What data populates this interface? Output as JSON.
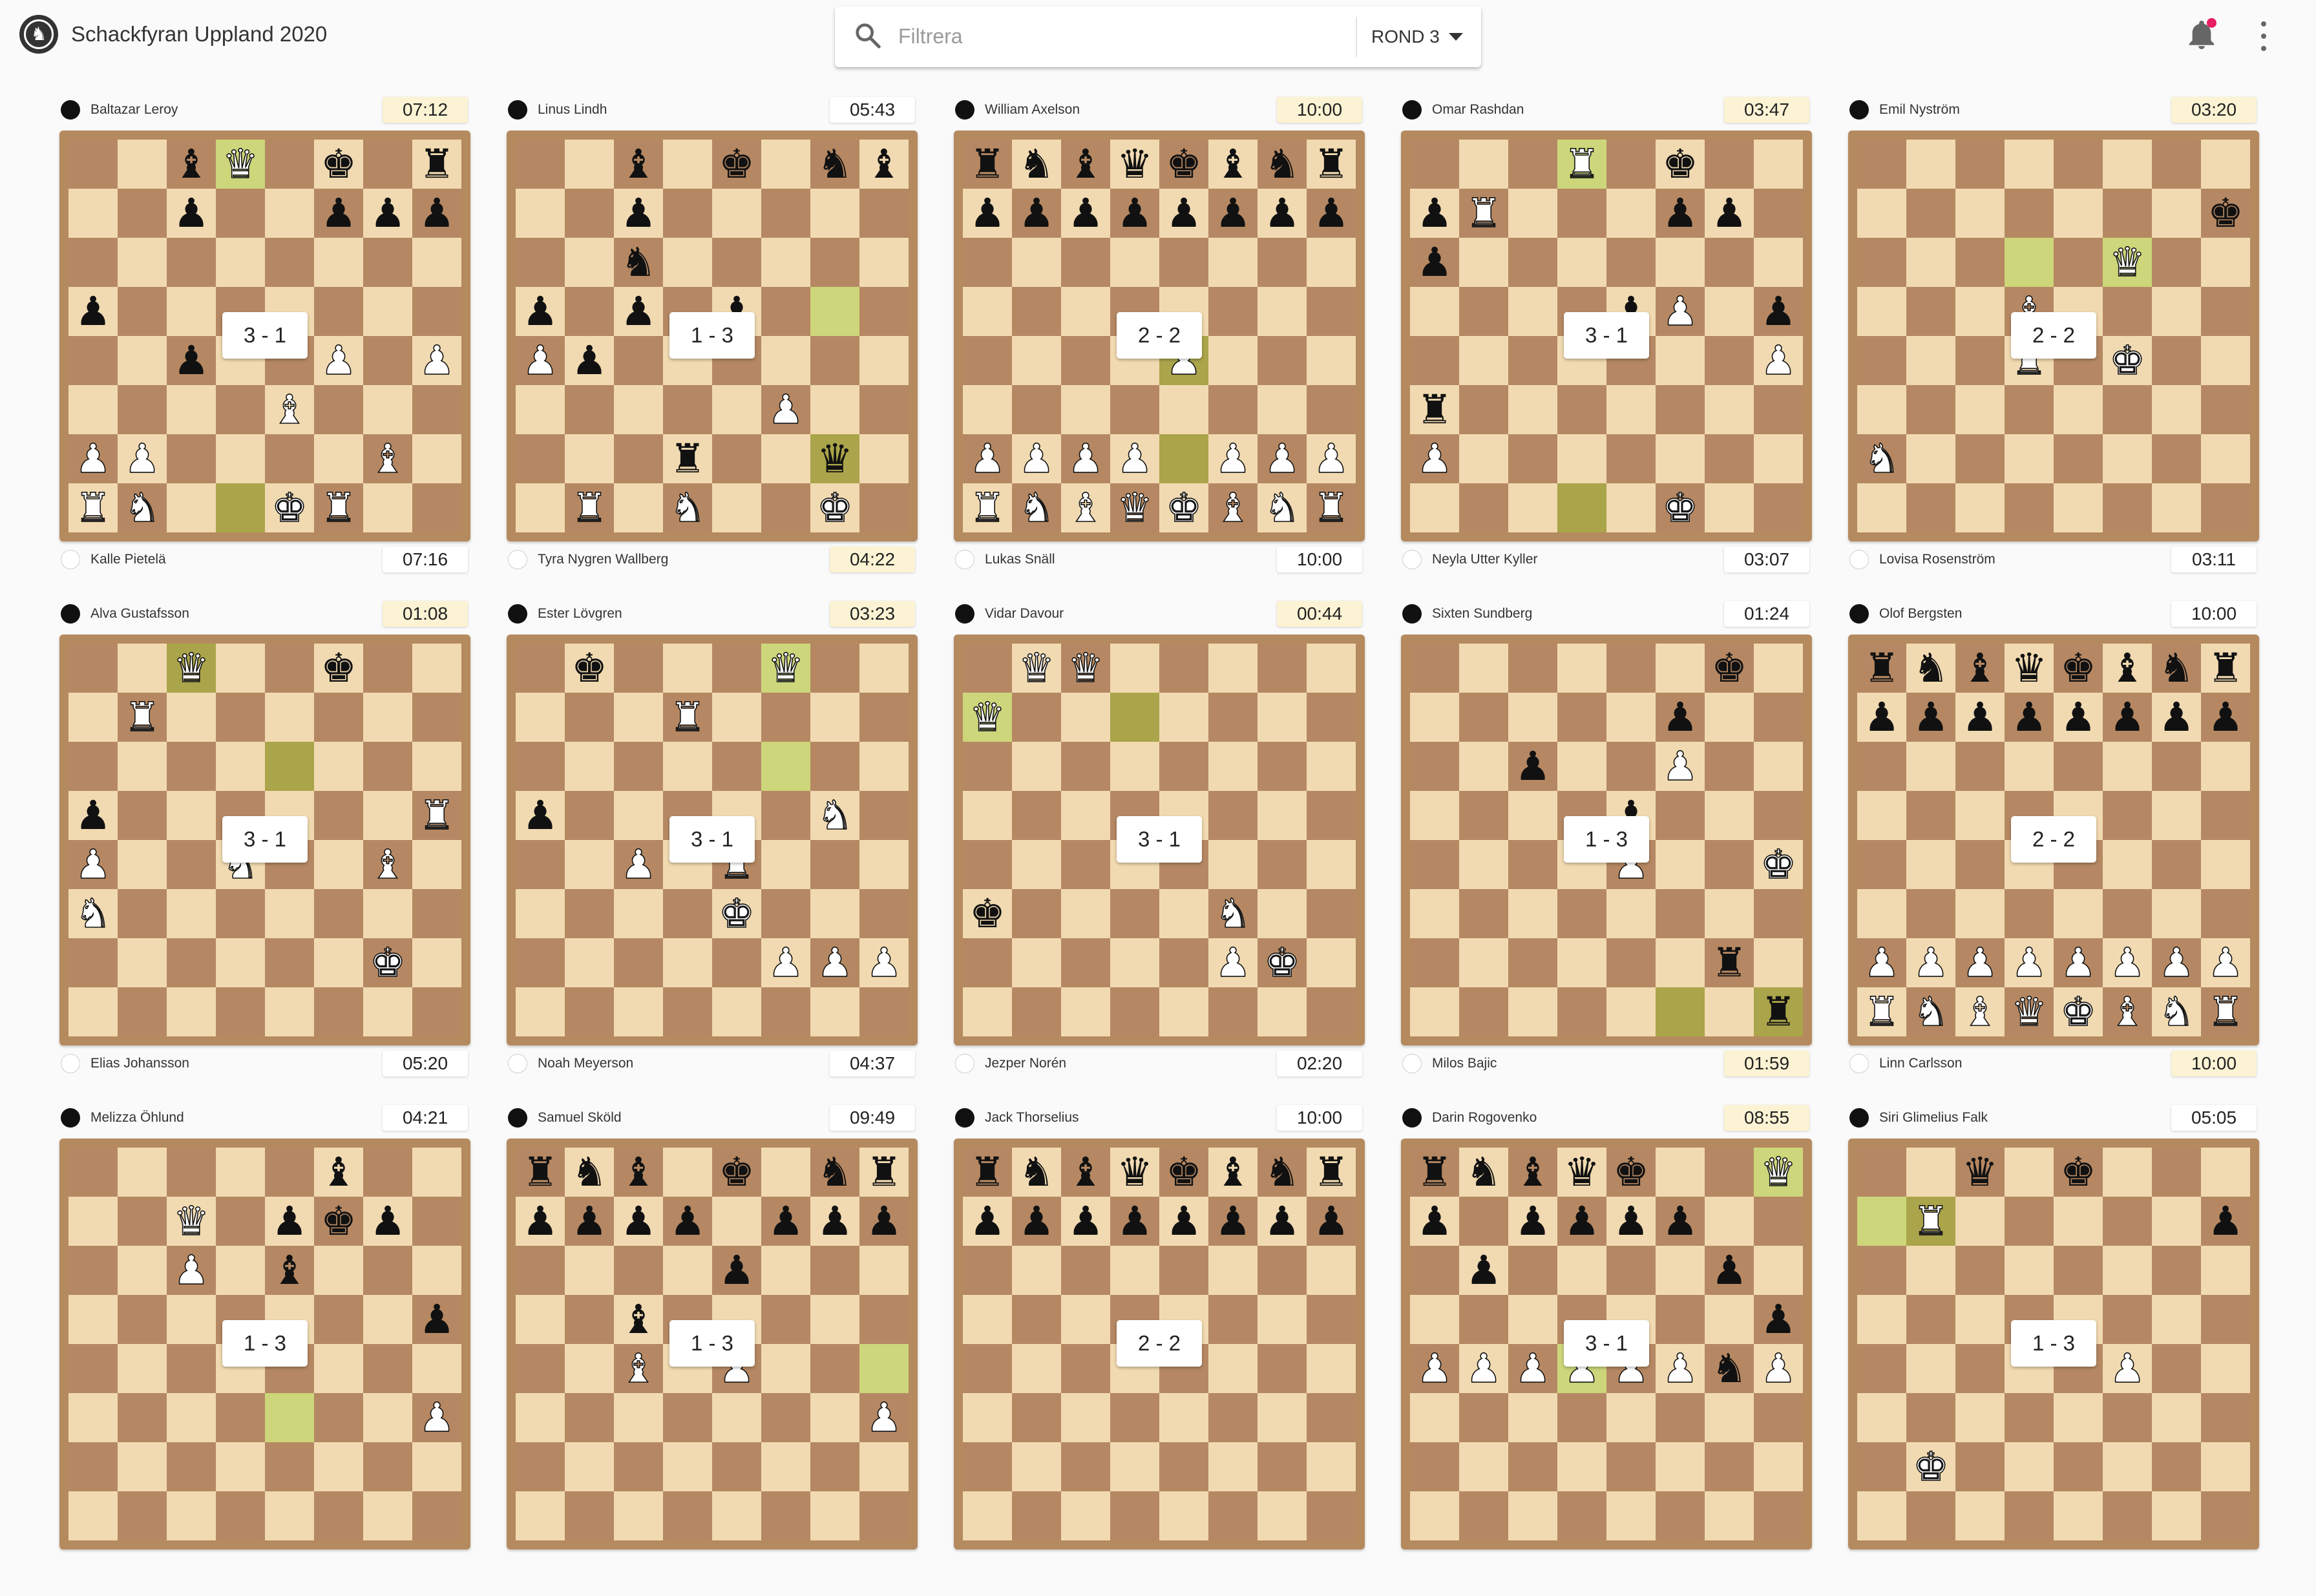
{
  "app": {
    "title": "Schackfyran Uppland 2020"
  },
  "search": {
    "placeholder": "Filtrera",
    "value": ""
  },
  "round": {
    "label": "ROND 3"
  },
  "colors": {
    "light_square": "#f1dab1",
    "dark_square": "#b58863",
    "highlight": "#cdd67a",
    "board_frame": "#b58a5f",
    "active_clock": "#fcf3d4",
    "notification_dot": "#e91e63"
  },
  "icons": {
    "logo": "chess-federation-logo",
    "search": "search-icon",
    "round_dropdown": "caret-down-icon",
    "notifications": "bell-icon",
    "menu": "more-vertical-icon"
  },
  "games": [
    {
      "top": {
        "name": "Baltazar Leroy",
        "color": "black",
        "clock": "07:12",
        "active": true
      },
      "bottom": {
        "name": "Kalle Pietelä",
        "color": "white",
        "clock": "07:16",
        "active": false
      },
      "score": "3 - 1",
      "highlights": [
        "d8",
        "d1"
      ],
      "pieces": {
        "c8": "bB",
        "d8": "wQ",
        "f8": "bK",
        "h8": "bR",
        "c7": "bP",
        "f7": "bP",
        "g7": "bP",
        "h7": "bP",
        "a5": "bP",
        "c4": "bP",
        "f4": "wP",
        "h4": "wP",
        "e3": "wB",
        "a2": "wP",
        "b2": "wP",
        "g2": "wB",
        "a1": "wR",
        "b1": "wN",
        "e1": "wK",
        "f1": "wR"
      }
    },
    {
      "top": {
        "name": "Linus Lindh",
        "color": "black",
        "clock": "05:43",
        "active": false
      },
      "bottom": {
        "name": "Tyra Nygren Wallberg",
        "color": "white",
        "clock": "04:22",
        "active": true
      },
      "score": "1 - 3",
      "highlights": [
        "g5",
        "g2"
      ],
      "pieces": {
        "c8": "bB",
        "e8": "bK",
        "g8": "bN",
        "h8": "bB",
        "c7": "bP",
        "c6": "bN",
        "a5": "bP",
        "c5": "bP",
        "e5": "bP",
        "a4": "wP",
        "b4": "bP",
        "f3": "wP",
        "d2": "bR",
        "g2": "bQ",
        "b1": "wR",
        "d1": "wN",
        "g1": "wK"
      }
    },
    {
      "top": {
        "name": "William Axelson",
        "color": "black",
        "clock": "10:00",
        "active": true
      },
      "bottom": {
        "name": "Lukas Snäll",
        "color": "white",
        "clock": "10:00",
        "active": false
      },
      "score": "2 - 2",
      "highlights": [
        "e4",
        "e2"
      ],
      "pieces": {
        "a8": "bR",
        "b8": "bN",
        "c8": "bB",
        "d8": "bQ",
        "e8": "bK",
        "f8": "bB",
        "g8": "bN",
        "h8": "bR",
        "a7": "bP",
        "b7": "bP",
        "c7": "bP",
        "d7": "bP",
        "e7": "bP",
        "f7": "bP",
        "g7": "bP",
        "h7": "bP",
        "e4": "wP",
        "a2": "wP",
        "b2": "wP",
        "c2": "wP",
        "d2": "wP",
        "f2": "wP",
        "g2": "wP",
        "h2": "wP",
        "a1": "wR",
        "b1": "wN",
        "c1": "wB",
        "d1": "wQ",
        "e1": "wK",
        "f1": "wB",
        "g1": "wN",
        "h1": "wR"
      }
    },
    {
      "top": {
        "name": "Omar Rashdan",
        "color": "black",
        "clock": "03:47",
        "active": true
      },
      "bottom": {
        "name": "Neyla Utter Kyller",
        "color": "white",
        "clock": "03:07",
        "active": false
      },
      "score": "3 - 1",
      "highlights": [
        "d8",
        "d1"
      ],
      "pieces": {
        "d8": "wR",
        "f8": "bK",
        "a7": "bP",
        "b7": "wR",
        "f7": "bP",
        "g7": "bP",
        "a6": "bP",
        "e5": "bP",
        "f5": "wP",
        "h5": "bP",
        "h4": "wP",
        "a3": "bR",
        "a2": "wP",
        "f1": "wK"
      }
    },
    {
      "top": {
        "name": "Emil Nyström",
        "color": "black",
        "clock": "03:20",
        "active": true
      },
      "bottom": {
        "name": "Lovisa Rosenström",
        "color": "white",
        "clock": "03:11",
        "active": false
      },
      "score": "2 - 2",
      "highlights": [
        "d6",
        "f6"
      ],
      "pieces": {
        "h7": "bK",
        "f6": "wQ",
        "d5": "wB",
        "d4": "wR",
        "f4": "wK",
        "a2": "wN"
      }
    },
    {
      "top": {
        "name": "Alva Gustafsson",
        "color": "black",
        "clock": "01:08",
        "active": true
      },
      "bottom": {
        "name": "Elias Johansson",
        "color": "white",
        "clock": "05:20",
        "active": false
      },
      "score": "3 - 1",
      "highlights": [
        "c8",
        "e6"
      ],
      "pieces": {
        "c8": "wQ",
        "f8": "bK",
        "b7": "wR",
        "a5": "bP",
        "h5": "wR",
        "a4": "wP",
        "d4": "wN",
        "g4": "wB",
        "a3": "wN",
        "g2": "wK"
      }
    },
    {
      "top": {
        "name": "Ester Lövgren",
        "color": "black",
        "clock": "03:23",
        "active": true
      },
      "bottom": {
        "name": "Noah Meyerson",
        "color": "white",
        "clock": "04:37",
        "active": false
      },
      "score": "3 - 1",
      "highlights": [
        "f8",
        "f6"
      ],
      "pieces": {
        "b8": "bK",
        "f8": "wQ",
        "d7": "wR",
        "a5": "bP",
        "g5": "wN",
        "c4": "wP",
        "e4": "wR",
        "e3": "wK",
        "f2": "wP",
        "g2": "wP",
        "h2": "wP"
      }
    },
    {
      "top": {
        "name": "Vidar Davour",
        "color": "black",
        "clock": "00:44",
        "active": true
      },
      "bottom": {
        "name": "Jezper Norén",
        "color": "white",
        "clock": "02:20",
        "active": false
      },
      "score": "3 - 1",
      "highlights": [
        "a7",
        "d7"
      ],
      "pieces": {
        "b8": "wQ",
        "c8": "wQ",
        "a7": "wQ",
        "a3": "bK",
        "f3": "wN",
        "f2": "wP",
        "g2": "wK"
      }
    },
    {
      "top": {
        "name": "Sixten Sundberg",
        "color": "black",
        "clock": "01:24",
        "active": false
      },
      "bottom": {
        "name": "Milos Bajic",
        "color": "white",
        "clock": "01:59",
        "active": true
      },
      "score": "1 - 3",
      "highlights": [
        "f1",
        "h1"
      ],
      "pieces": {
        "g8": "bK",
        "f7": "bP",
        "c6": "bP",
        "f6": "wP",
        "e5": "bP",
        "e4": "wP",
        "h4": "wK",
        "g2": "bR",
        "h1": "bR"
      }
    },
    {
      "top": {
        "name": "Olof Bergsten",
        "color": "black",
        "clock": "10:00",
        "active": false
      },
      "bottom": {
        "name": "Linn Carlsson",
        "color": "white",
        "clock": "10:00",
        "active": true
      },
      "score": "2 - 2",
      "highlights": [],
      "pieces": {
        "a8": "bR",
        "b8": "bN",
        "c8": "bB",
        "d8": "bQ",
        "e8": "bK",
        "f8": "bB",
        "g8": "bN",
        "h8": "bR",
        "a7": "bP",
        "b7": "bP",
        "c7": "bP",
        "d7": "bP",
        "e7": "bP",
        "f7": "bP",
        "g7": "bP",
        "h7": "bP",
        "a2": "wP",
        "b2": "wP",
        "c2": "wP",
        "d2": "wP",
        "e2": "wP",
        "f2": "wP",
        "g2": "wP",
        "h2": "wP",
        "a1": "wR",
        "b1": "wN",
        "c1": "wB",
        "d1": "wQ",
        "e1": "wK",
        "f1": "wB",
        "g1": "wN",
        "h1": "wR"
      }
    },
    {
      "top": {
        "name": "Melizza Öhlund",
        "color": "black",
        "clock": "04:21",
        "active": false
      },
      "bottom": {
        "name": "",
        "color": "white",
        "clock": "",
        "active": false
      },
      "score": "1 - 3",
      "highlights": [
        "e3"
      ],
      "pieces": {
        "f8": "bB",
        "c7": "wQ",
        "e7": "bP",
        "f7": "bK",
        "g7": "bP",
        "c6": "wP",
        "e6": "bB",
        "h5": "bP",
        "h3": "wP"
      }
    },
    {
      "top": {
        "name": "Samuel Sköld",
        "color": "black",
        "clock": "09:49",
        "active": false
      },
      "bottom": {
        "name": "",
        "color": "white",
        "clock": "",
        "active": false
      },
      "score": "1 - 3",
      "highlights": [
        "h4"
      ],
      "pieces": {
        "a8": "bR",
        "b8": "bN",
        "c8": "bB",
        "e8": "bK",
        "g8": "bN",
        "h8": "bR",
        "a7": "bP",
        "b7": "bP",
        "c7": "bP",
        "d7": "bP",
        "f7": "bP",
        "g7": "bP",
        "h7": "bP",
        "e6": "bP",
        "c5": "bB",
        "c4": "wB",
        "e4": "wP",
        "h3": "wP"
      }
    },
    {
      "top": {
        "name": "Jack Thorselius",
        "color": "black",
        "clock": "10:00",
        "active": false
      },
      "bottom": {
        "name": "",
        "color": "white",
        "clock": "",
        "active": false
      },
      "score": "2 - 2",
      "highlights": [],
      "pieces": {
        "a8": "bR",
        "b8": "bN",
        "c8": "bB",
        "d8": "bQ",
        "e8": "bK",
        "f8": "bB",
        "g8": "bN",
        "h8": "bR",
        "a7": "bP",
        "b7": "bP",
        "c7": "bP",
        "d7": "bP",
        "e7": "bP",
        "f7": "bP",
        "g7": "bP",
        "h7": "bP"
      }
    },
    {
      "top": {
        "name": "Darin Rogovenko",
        "color": "black",
        "clock": "08:55",
        "active": true
      },
      "bottom": {
        "name": "",
        "color": "white",
        "clock": "",
        "active": false
      },
      "score": "3 - 1",
      "highlights": [
        "h8",
        "d4"
      ],
      "pieces": {
        "a8": "bR",
        "b8": "bN",
        "c8": "bB",
        "d8": "bQ",
        "e8": "bK",
        "h8": "wQ",
        "a7": "bP",
        "c7": "bP",
        "d7": "bP",
        "e7": "bP",
        "f7": "bP",
        "b6": "bP",
        "g6": "bP",
        "h5": "bP",
        "a4": "wP",
        "b4": "wP",
        "c4": "wP",
        "d4": "wP",
        "e4": "wP",
        "f4": "wP",
        "g4": "bN",
        "h4": "wP"
      }
    },
    {
      "top": {
        "name": "Siri Glimelius Falk",
        "color": "black",
        "clock": "05:05",
        "active": false
      },
      "bottom": {
        "name": "",
        "color": "white",
        "clock": "",
        "active": false
      },
      "score": "1 - 3",
      "highlights": [
        "a7",
        "b7"
      ],
      "pieces": {
        "c8": "bQ",
        "e8": "bK",
        "b7": "wR",
        "h7": "bP",
        "f4": "wP",
        "b2": "wK"
      }
    }
  ]
}
